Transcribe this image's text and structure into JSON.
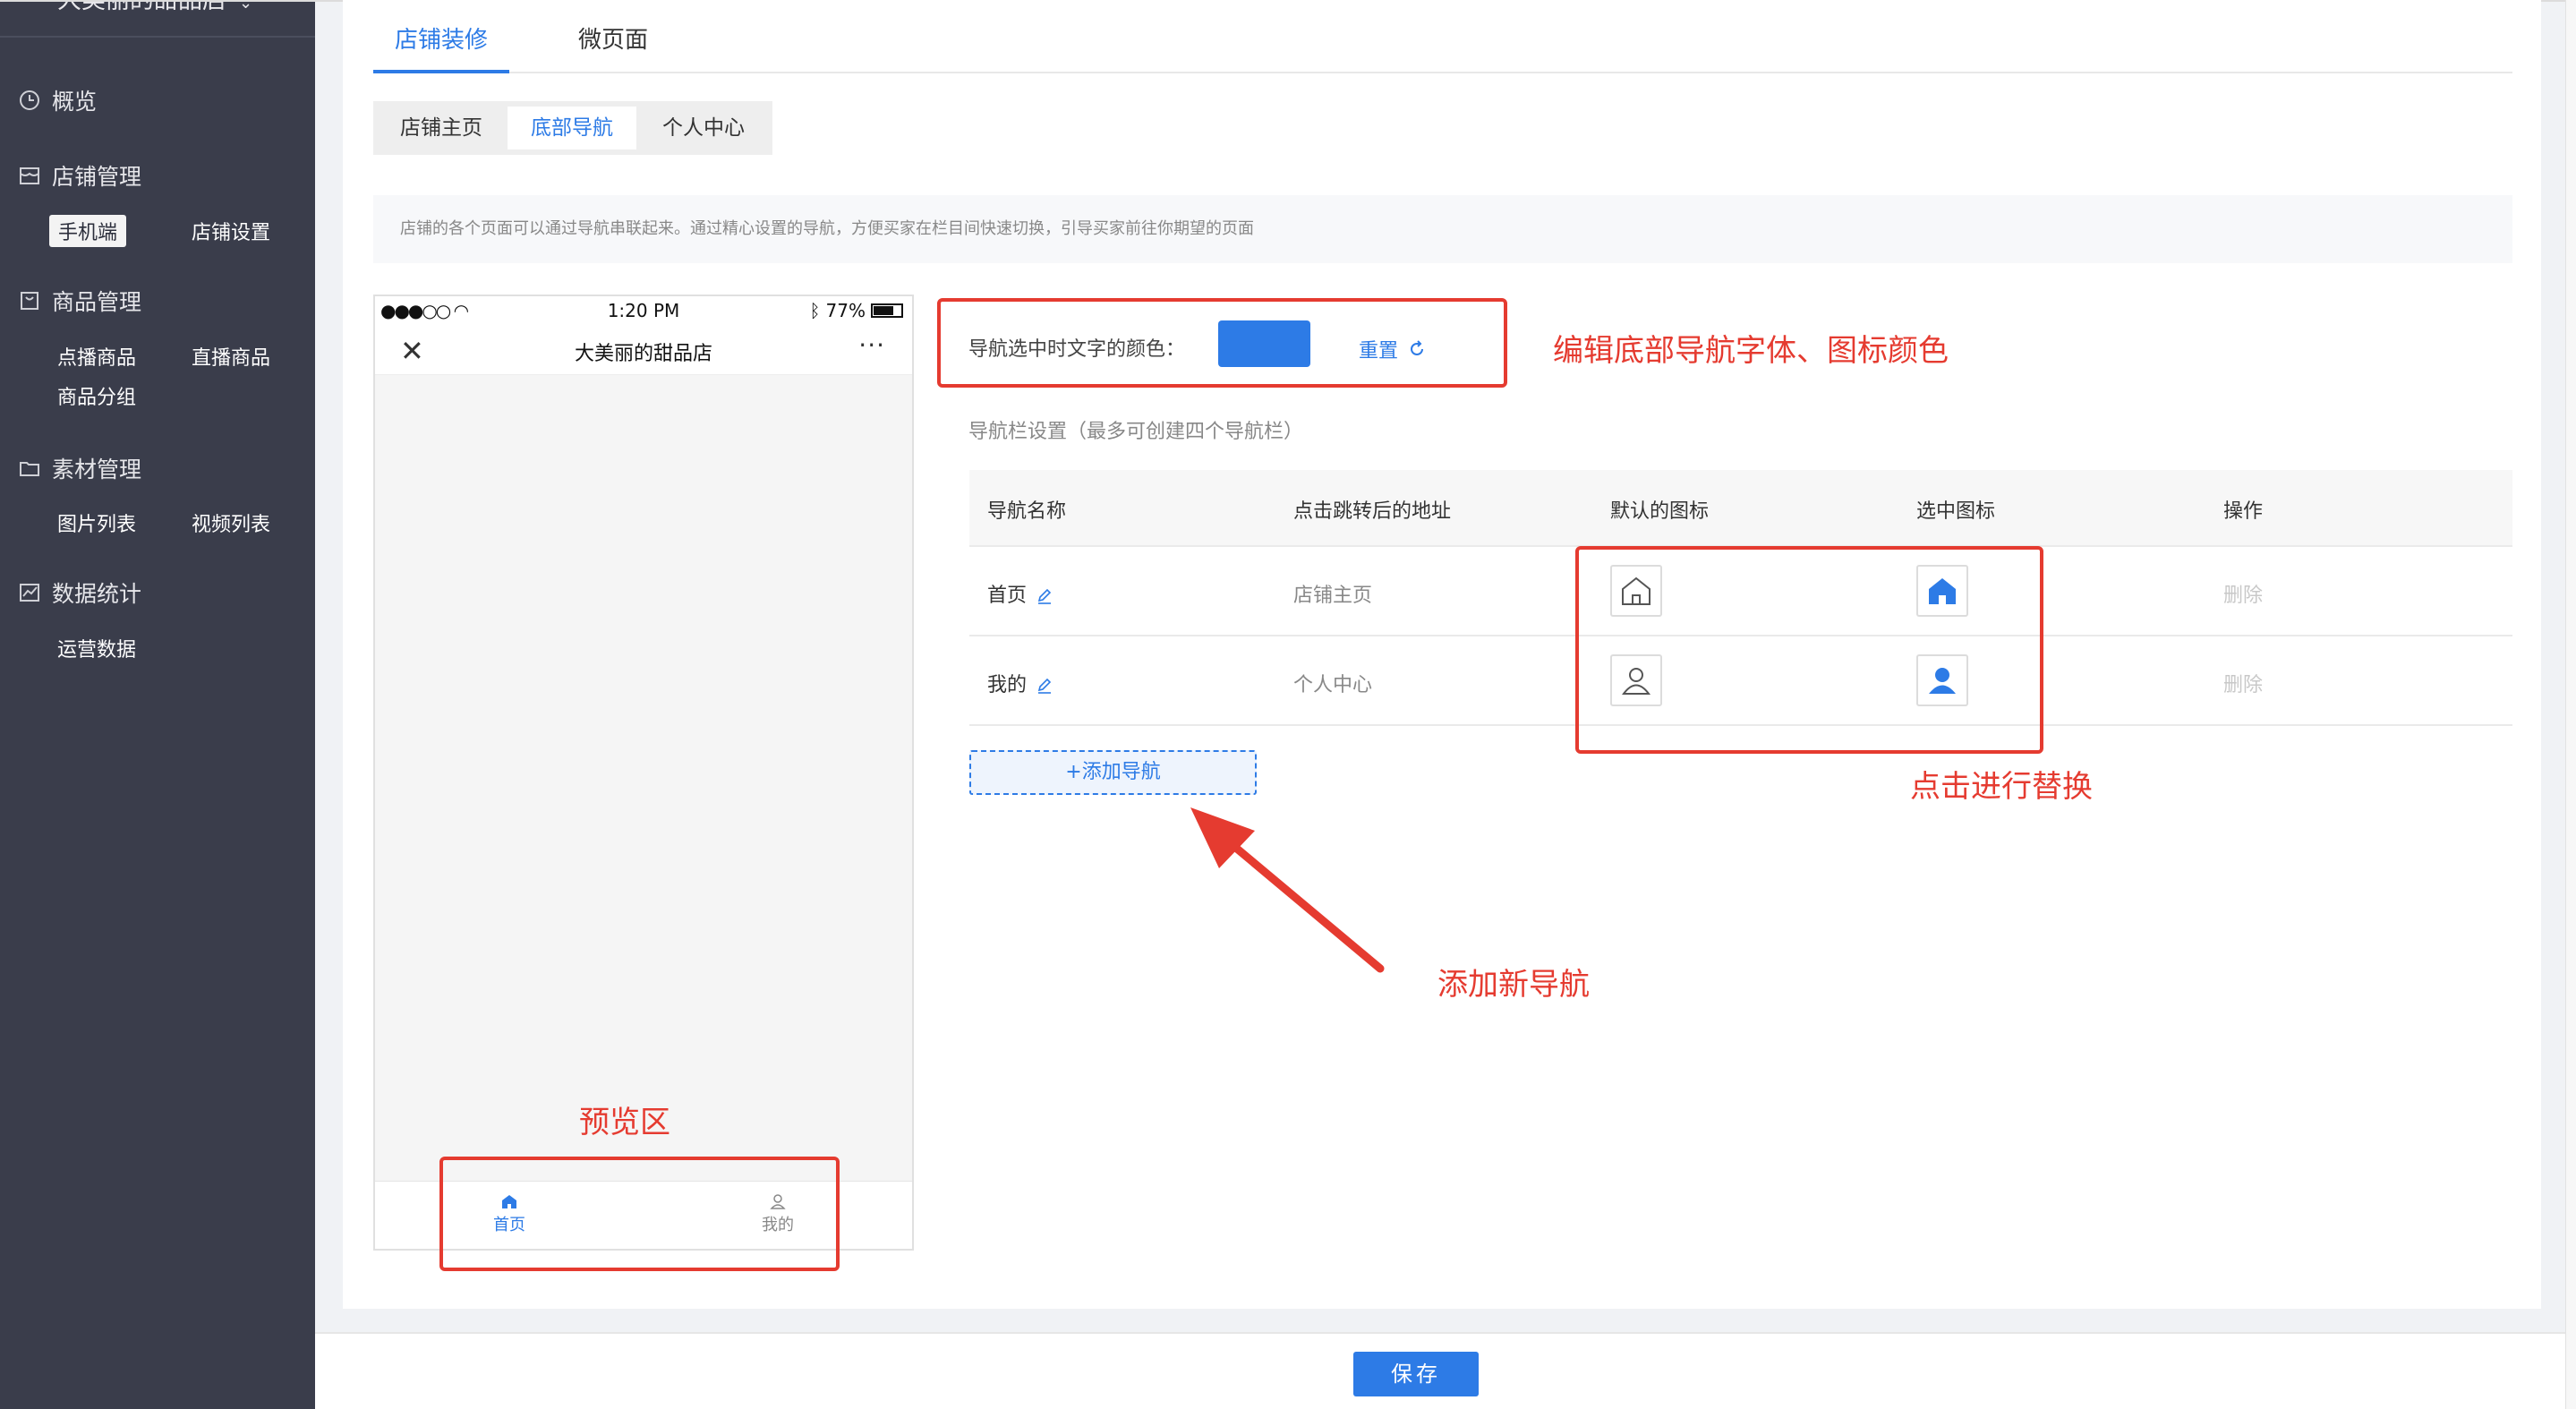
{
  "sidebar": {
    "store_name": "大美丽的甜品店",
    "menu": [
      {
        "title": "概览",
        "icon": "clock-icon"
      },
      {
        "title": "店铺管理",
        "icon": "shop-icon",
        "items": [
          "手机端",
          "店铺设置"
        ],
        "active": "手机端"
      },
      {
        "title": "商品管理",
        "icon": "goods-icon",
        "items": [
          "点播商品",
          "直播商品",
          "商品分组"
        ]
      },
      {
        "title": "素材管理",
        "icon": "folder-icon",
        "items": [
          "图片列表",
          "视频列表"
        ]
      },
      {
        "title": "数据统计",
        "icon": "chart-icon",
        "items": [
          "运营数据"
        ]
      }
    ]
  },
  "tabs": [
    "店铺装修",
    "微页面"
  ],
  "active_tab": "店铺装修",
  "segments": [
    "店铺主页",
    "底部导航",
    "个人中心"
  ],
  "active_segment": "底部导航",
  "notice": "店铺的各个页面可以通过导航串联起来。通过精心设置的导航，方便买家在栏目间快速切换，引导买家前往你期望的页面",
  "phone": {
    "time": "1:20 PM",
    "battery": "77%",
    "title": "大美丽的甜品店",
    "tabbar": [
      "首页",
      "我的"
    ]
  },
  "color_setting": {
    "label": "导航选中时文字的颜色：",
    "swatch_color": "#2d7be6",
    "reset_label": "重置"
  },
  "nav_settings_title": "导航栏设置（最多可创建四个导航栏）",
  "table": {
    "headers": [
      "导航名称",
      "点击跳转后的地址",
      "默认的图标",
      "选中图标",
      "操作"
    ],
    "rows": [
      {
        "name": "首页",
        "link": "店铺主页",
        "default_icon": "home-outline-icon",
        "selected_icon": "home-filled-icon",
        "action": "删除"
      },
      {
        "name": "我的",
        "link": "个人中心",
        "default_icon": "user-outline-icon",
        "selected_icon": "user-filled-icon",
        "action": "删除"
      }
    ]
  },
  "add_nav_label": "+添加导航",
  "annotations": {
    "edit_color": "编辑底部导航字体、图标颜色",
    "click_replace": "点击进行替换",
    "add_new": "添加新导航",
    "preview": "预览区"
  },
  "save_label": "保存",
  "accent_color": "#2d7be6",
  "annotation_color": "#e53b30"
}
